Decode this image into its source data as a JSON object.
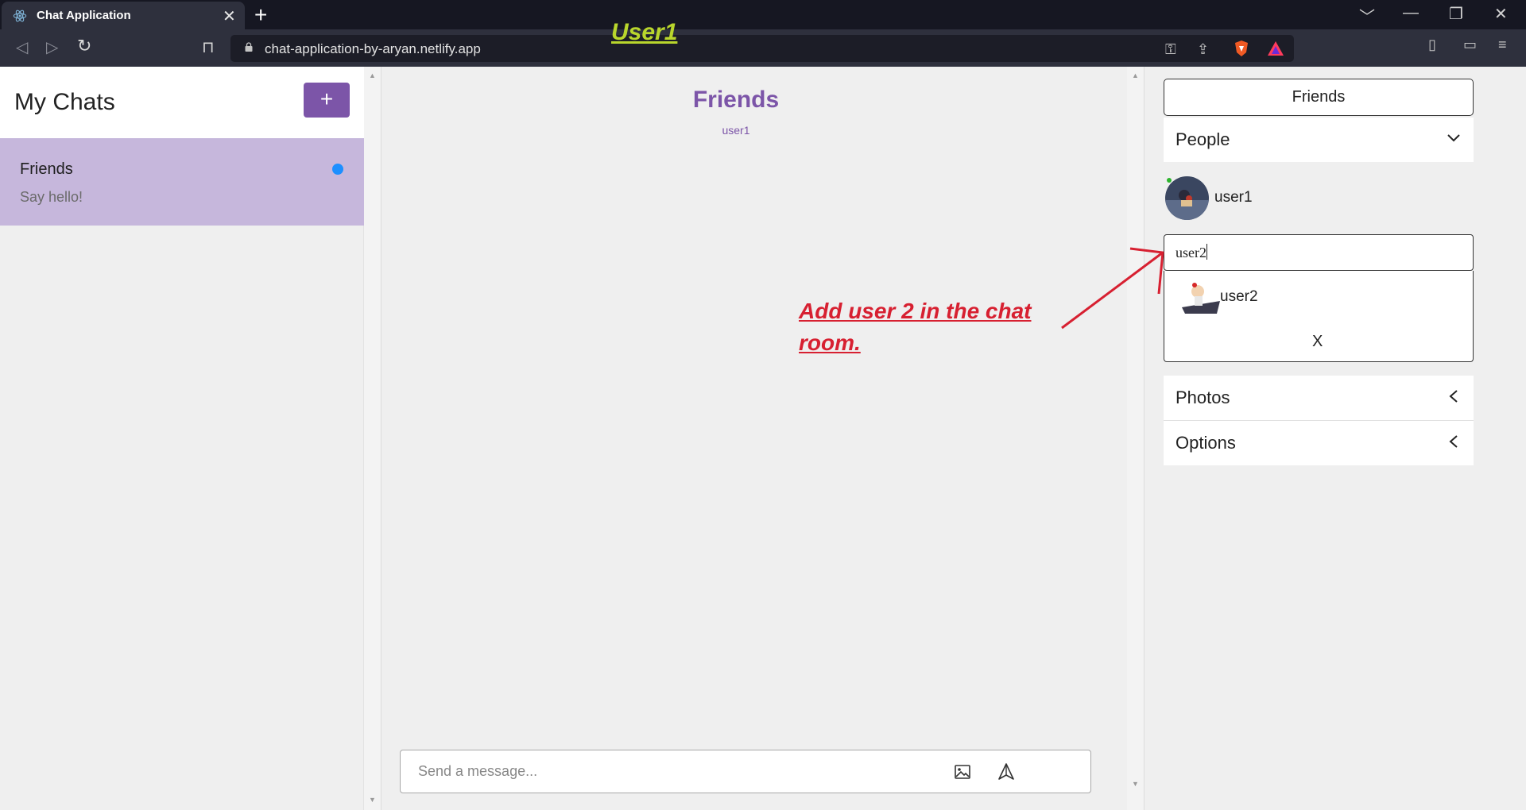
{
  "browser": {
    "tab_title": "Chat Application",
    "tab_close": "✕",
    "new_tab": "+",
    "url": "chat-application-by-aryan.netlify.app",
    "window_controls": [
      "﹀",
      "—",
      "❐",
      "✕"
    ],
    "nav": {
      "back": "◁",
      "forward": "▷",
      "reload": "↻",
      "bookmark": "⊓"
    },
    "url_icons": [
      "⚿",
      "⇪"
    ],
    "toolbar_icons": [
      "▯",
      "▭",
      "≡"
    ]
  },
  "overlay_label": "User1",
  "sidebar": {
    "title": "My Chats",
    "add_label": "+",
    "chats": [
      {
        "name": "Friends",
        "preview": "Say hello!"
      }
    ]
  },
  "feed": {
    "title": "Friends",
    "subtitle": "user1",
    "annotation_line1": "Add user 2 in the chat",
    "annotation_line2": "room.",
    "message_placeholder": "Send a message..."
  },
  "settings": {
    "title": "Friends",
    "people_label": "People",
    "people": [
      {
        "name": "user1"
      }
    ],
    "search_value": "user2",
    "results": [
      {
        "name": "user2"
      }
    ],
    "close_label": "X",
    "photos_label": "Photos",
    "options_label": "Options"
  },
  "icons": {
    "tab_favicon": "react-atom-icon",
    "image_upload": "image-icon",
    "send": "send-arrow-icon",
    "people_toggle": "chevron-down-icon",
    "photos_toggle": "chevron-left-icon",
    "options_toggle": "chevron-left-icon"
  },
  "colors": {
    "accent": "#7c55a8",
    "chat_selected": "#c6b7dc",
    "unread": "#1d8fff",
    "annotation": "#d72031",
    "overlay_label": "#b9d62c"
  }
}
